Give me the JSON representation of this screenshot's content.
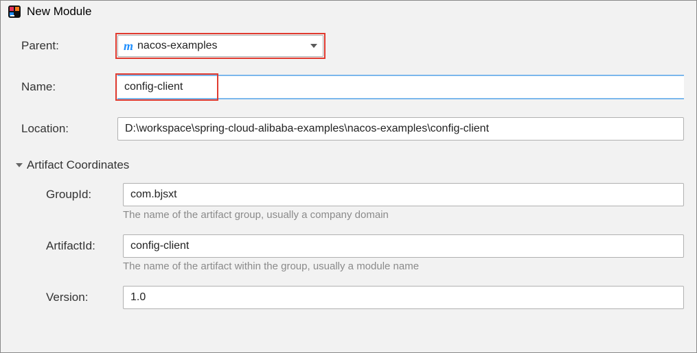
{
  "window": {
    "title": "New Module"
  },
  "form": {
    "parent_label": "Parent:",
    "parent_value": "nacos-examples",
    "name_label": "Name:",
    "name_value": "config-client",
    "location_label": "Location:",
    "location_value": "D:\\workspace\\spring-cloud-alibaba-examples\\nacos-examples\\config-client"
  },
  "artifact": {
    "section_title": "Artifact Coordinates",
    "groupId_label": "GroupId:",
    "groupId_value": "com.bjsxt",
    "groupId_hint": "The name of the artifact group, usually a company domain",
    "artifactId_label": "ArtifactId:",
    "artifactId_value": "config-client",
    "artifactId_hint": "The name of the artifact within the group, usually a module name",
    "version_label": "Version:",
    "version_value": "1.0"
  }
}
